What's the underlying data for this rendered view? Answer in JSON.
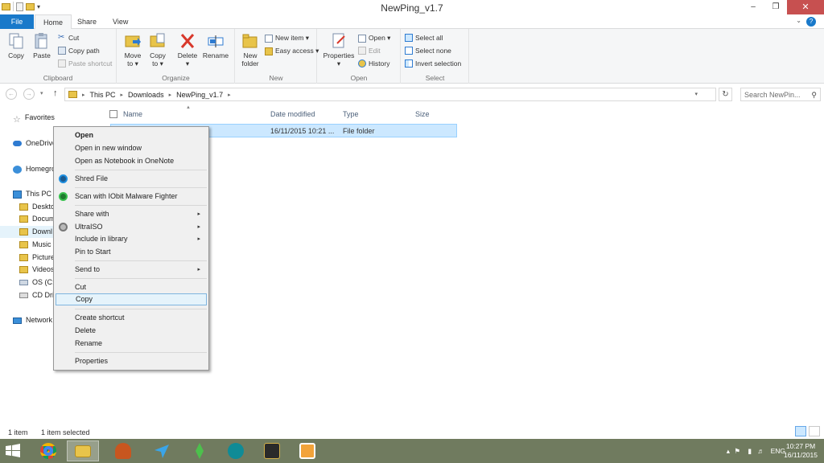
{
  "window": {
    "title": "NewPing_v1.7",
    "buttons": {
      "minimize": "–",
      "maximize": "❐",
      "close": "✕"
    }
  },
  "ribbon_tabs": {
    "file": "File",
    "home": "Home",
    "share": "Share",
    "view": "View"
  },
  "ribbon": {
    "clipboard": {
      "label": "Clipboard",
      "copy": "Copy",
      "paste": "Paste",
      "cut": "Cut",
      "copy_path": "Copy path",
      "paste_shortcut": "Paste shortcut"
    },
    "organize": {
      "label": "Organize",
      "move_to": "Move",
      "move_to_2": "to ▾",
      "copy_to": "Copy",
      "copy_to_2": "to ▾",
      "delete": "Delete",
      "delete_2": "▾",
      "rename": "Rename"
    },
    "new": {
      "label": "New",
      "new_folder": "New",
      "new_folder_2": "folder",
      "new_item": "New item ▾",
      "easy_access": "Easy access ▾"
    },
    "open": {
      "label": "Open",
      "properties": "Properties",
      "properties_2": "▾",
      "open": "Open ▾",
      "edit": "Edit",
      "history": "History"
    },
    "select": {
      "label": "Select",
      "select_all": "Select all",
      "select_none": "Select none",
      "invert": "Invert selection"
    }
  },
  "address_bar": {
    "segments": [
      "This PC",
      "Downloads",
      "NewPing_v1.7"
    ],
    "search_placeholder": "Search NewPin..."
  },
  "nav_pane": {
    "favorites": "Favorites",
    "onedrive": "OneDrive",
    "homegroup": "Homegro",
    "this_pc": "This PC",
    "desktop": "Deskto",
    "documents": "Docum",
    "downloads": "Downl",
    "music": "Music",
    "pictures": "Picture",
    "videos": "Videos",
    "os_c": "OS (C:)",
    "cd_drive": "CD Driv",
    "network": "Network"
  },
  "columns": {
    "name": "Name",
    "date_modified": "Date modified",
    "type": "Type",
    "size": "Size"
  },
  "file_row": {
    "date": "16/11/2015 10:21 ...",
    "type": "File folder"
  },
  "context_menu": {
    "open": "Open",
    "open_new_window": "Open in new window",
    "open_onenote": "Open as Notebook in OneNote",
    "shred": "Shred File",
    "scan": "Scan with IObit Malware Fighter",
    "share_with": "Share with",
    "ultraiso": "UltraISO",
    "include_library": "Include in library",
    "pin_start": "Pin to Start",
    "send_to": "Send to",
    "cut": "Cut",
    "copy": "Copy",
    "create_shortcut": "Create shortcut",
    "delete": "Delete",
    "rename": "Rename",
    "properties": "Properties"
  },
  "status": {
    "count": "1 item",
    "selected": "1 item selected"
  },
  "taskbar": {
    "lang": "ENG",
    "time": "10:27 PM",
    "date": "16/11/2015"
  },
  "colors": {
    "accent": "#1979ca",
    "selection": "#cce8ff",
    "close": "#c75050",
    "taskbar": "#707b5f"
  }
}
